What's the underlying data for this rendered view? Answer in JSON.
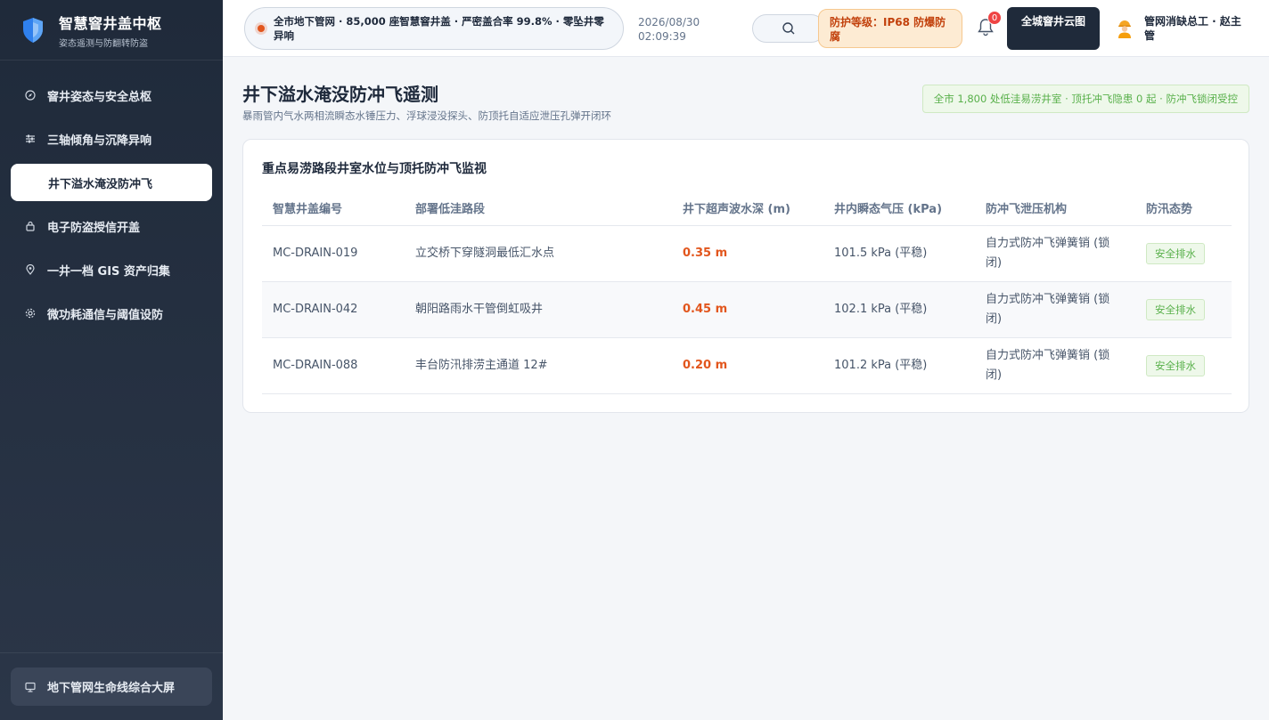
{
  "brand": {
    "title": "智慧窨井盖中枢",
    "subtitle": "姿态遥测与防翻转防盗"
  },
  "sidebar": {
    "items": [
      {
        "label": "窨井姿态与安全总枢",
        "icon": "compass-icon",
        "active": false
      },
      {
        "label": "三轴倾角与沉降异响",
        "icon": "sliders-icon",
        "active": false
      },
      {
        "label": "井下溢水淹没防冲飞",
        "icon": "",
        "active": true
      },
      {
        "label": "电子防盗授信开盖",
        "icon": "lock-icon",
        "active": false
      },
      {
        "label": "一井一档 GIS 资产归集",
        "icon": "map-pin-icon",
        "active": false
      },
      {
        "label": "微功耗通信与阈值设防",
        "icon": "gear-icon",
        "active": false
      }
    ],
    "bottom_label": "地下管网生命线综合大屏"
  },
  "topbar": {
    "ticker": "全市地下管网 · 85,000 座智慧窨井盖 · 严密盖合率 99.8% · 零坠井零异响",
    "date": "2026/08/30",
    "time": "02:09:39",
    "protection": "防护等级：IP68 防爆防腐",
    "notification_count": "0",
    "cloud_button": "全城窨井云图",
    "user": "管网消缺总工 · 赵主管"
  },
  "main": {
    "title": "井下溢水淹没防冲飞遥测",
    "subtitle": "暴雨管内气水两相流瞬态水锤压力、浮球浸没探头、防顶托自适应泄压孔弹开闭环",
    "status_pill": "全市 1,800 处低洼易涝井室 · 顶托冲飞隐患 0 起 · 防冲飞锁闭受控"
  },
  "card": {
    "title": "重点易涝路段井室水位与顶托防冲飞监视",
    "columns": [
      "智慧井盖编号",
      "部署低洼路段",
      "井下超声波水深 (m)",
      "井内瞬态气压 (kPa)",
      "防冲飞泄压机构",
      "防汛态势"
    ],
    "rows": [
      {
        "id": "MC-DRAIN-019",
        "location": "立交桥下穿隧洞最低汇水点",
        "depth": "0.35 m",
        "pressure": "101.5 kPa (平稳)",
        "mechanism": "自力式防冲飞弹簧销 (锁闭)",
        "status": "安全排水"
      },
      {
        "id": "MC-DRAIN-042",
        "location": "朝阳路雨水干管倒虹吸井",
        "depth": "0.45 m",
        "pressure": "102.1 kPa (平稳)",
        "mechanism": "自力式防冲飞弹簧销 (锁闭)",
        "status": "安全排水"
      },
      {
        "id": "MC-DRAIN-088",
        "location": "丰台防汛排涝主通道 12#",
        "depth": "0.20 m",
        "pressure": "101.2 kPa (平稳)",
        "mechanism": "自力式防冲飞弹簧销 (锁闭)",
        "status": "安全排水"
      }
    ]
  },
  "colors": {
    "accent_orange": "#e2561d",
    "safe_green": "#58b04a",
    "sidebar_dark": "#1f2a3a"
  }
}
